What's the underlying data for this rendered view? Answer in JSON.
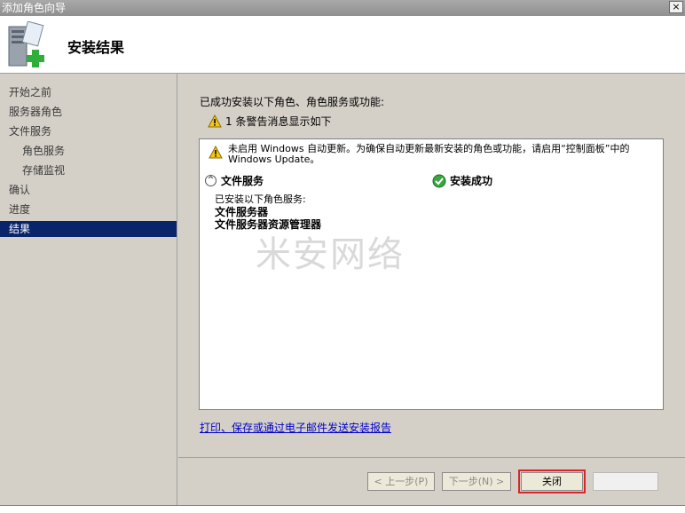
{
  "window": {
    "title": "添加角色向导",
    "close_label": "×"
  },
  "header": {
    "title": "安装结果"
  },
  "sidebar": {
    "items": [
      {
        "label": "开始之前",
        "indent": false,
        "active": false
      },
      {
        "label": "服务器角色",
        "indent": false,
        "active": false
      },
      {
        "label": "文件服务",
        "indent": false,
        "active": false
      },
      {
        "label": "角色服务",
        "indent": true,
        "active": false
      },
      {
        "label": "存储监视",
        "indent": true,
        "active": false
      },
      {
        "label": "确认",
        "indent": false,
        "active": false
      },
      {
        "label": "进度",
        "indent": false,
        "active": false
      },
      {
        "label": "结果",
        "indent": false,
        "active": true
      }
    ]
  },
  "main": {
    "lead": "已成功安装以下角色、角色服务或功能:",
    "warning_summary": "1 条警告消息显示如下",
    "message": "未启用 Windows 自动更新。为确保自动更新最新安装的角色或功能，请启用“控制面板”中的 Windows Update。",
    "section": {
      "name": "文件服务",
      "status": "安装成功"
    },
    "detail_intro": "已安装以下角色服务:",
    "detail_items": [
      "文件服务器",
      "文件服务器资源管理器"
    ],
    "watermark": "米安网络",
    "report_link": "打印、保存或通过电子邮件发送安装报告"
  },
  "footer": {
    "prev_label": "< 上一步(P)",
    "next_label": "下一步(N) >",
    "close_label": "关闭",
    "cancel_label": ""
  },
  "colors": {
    "active_nav": "#0a246a",
    "link": "#0000cc",
    "highlight": "#d6262b"
  }
}
